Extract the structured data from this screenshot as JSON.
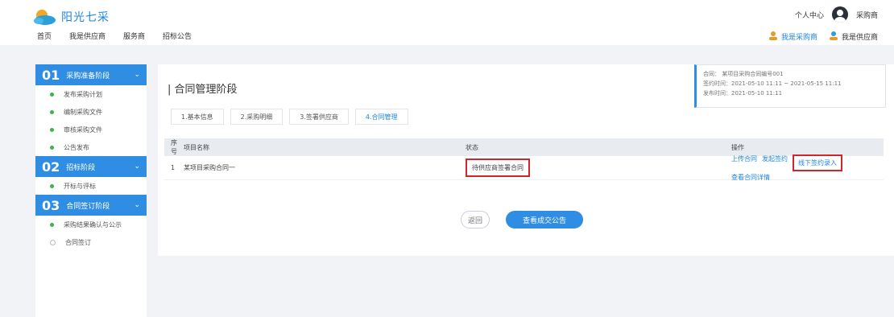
{
  "brand": {
    "name": "阳光七采"
  },
  "nav": {
    "items": [
      "首页",
      "我是供应商",
      "服务商",
      "招标公告"
    ]
  },
  "user": {
    "center_label": "个人中心",
    "name": "采购商"
  },
  "top_links": [
    {
      "label": "我是采购商",
      "icon": "user-buyer-icon",
      "color": "#e89a2a"
    },
    {
      "label": "我是供应商",
      "icon": "user-supplier-icon",
      "color": "#2a9fd8"
    }
  ],
  "sidebar": {
    "sections": [
      {
        "number": "01",
        "title": "采购准备阶段",
        "items": [
          {
            "label": "发布采购计划"
          },
          {
            "label": "编制采购文件"
          },
          {
            "label": "审核采购文件"
          },
          {
            "label": "公告发布"
          }
        ]
      },
      {
        "number": "02",
        "title": "招标阶段",
        "items": [
          {
            "label": "开标与评标"
          }
        ]
      },
      {
        "number": "03",
        "title": "合同签订阶段",
        "items": [
          {
            "label": "采购结果确认与公示"
          },
          {
            "label": "合同签订"
          }
        ]
      }
    ]
  },
  "main": {
    "title": "| 合同管理阶段",
    "steps": [
      "1.基本信息",
      "2.采购明细",
      "3.签署供应商",
      "4.合同管理"
    ],
    "table": {
      "headers": [
        "序号",
        "项目名称",
        "状态",
        "操作"
      ],
      "rows": [
        {
          "index": "1",
          "name": "某项目采购合同一",
          "status": "待供应商签署合同",
          "ops": [
            "上传合同",
            "发起签约",
            "线下签约录入",
            "查看合同详情"
          ]
        }
      ]
    },
    "back_button": "返回",
    "primary_button": "查看成交公告"
  },
  "info_card": {
    "line1": "合同：  某项目采购合同编号001",
    "line2": "签约时间：2021-05-10 11:11 ~ 2021-05-15 11:11",
    "line3": "发布时间：2021-05-10 11:11"
  },
  "colors": {
    "accent": "#2f8de4",
    "highlight": "#d0262b",
    "success": "#39b54a"
  }
}
